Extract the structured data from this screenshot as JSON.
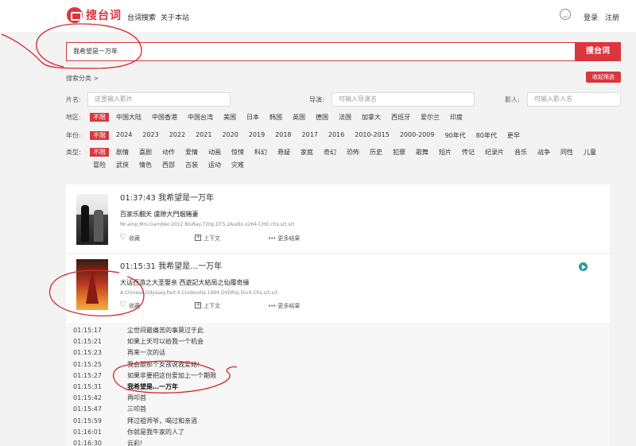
{
  "header": {
    "logo_text": "搜台词",
    "nav": [
      "台词搜索",
      "关于本站"
    ],
    "login": "登录",
    "register": "注册"
  },
  "search": {
    "value": "我希望是一万年",
    "button": "搜台词"
  },
  "category_link": "搜索分类 >",
  "advanced_button": "收起筛选",
  "fields": {
    "title_label": "片名:",
    "title_placeholder": "这里输入影片",
    "director_label": "导演:",
    "director_placeholder": "可输入导演名",
    "actor_label": "影人:",
    "actor_placeholder": "可输入影人名"
  },
  "filters": {
    "region": {
      "label": "地区:",
      "options": [
        "不限",
        "中国大陆",
        "中国香港",
        "中国台湾",
        "美国",
        "日本",
        "韩国",
        "英国",
        "德国",
        "法国",
        "加拿大",
        "西班牙",
        "爱尔兰",
        "印度"
      ]
    },
    "year": {
      "label": "年份:",
      "options": [
        "不限",
        "2024",
        "2023",
        "2022",
        "2021",
        "2020",
        "2019",
        "2018",
        "2017",
        "2016",
        "2010-2015",
        "2000-2009",
        "90年代",
        "80年代",
        "更早"
      ]
    },
    "genre": {
      "label": "类型:",
      "options": [
        "不限",
        "剧情",
        "喜剧",
        "动作",
        "爱情",
        "动画",
        "惊悚",
        "科幻",
        "悬疑",
        "家庭",
        "奇幻",
        "恐怖",
        "历史",
        "犯罪",
        "歌舞",
        "短片",
        "传记",
        "纪录片",
        "音乐",
        "战争",
        "同性",
        "儿童",
        "冒险",
        "武侠",
        "情色",
        "西部",
        "古装",
        "运动",
        "灾难"
      ]
    }
  },
  "results": [
    {
      "time": "01:37:43",
      "quote": "我希望是一万年",
      "title": "百家乐翻天 虞隙大門烟赌妻",
      "file": "Mr.amp;Mrs.Gambler.2012.BluRay.720p.DTS.2Audio.x264-CHD.chs.srt.srt",
      "favorite": "收藏",
      "context": "上下文",
      "more": "更多结果"
    },
    {
      "time": "01:15:31",
      "quote": "我希望是…一万年",
      "title": "大话西游之大圣娶亲 西遊記大結局之仙履奇緣",
      "file": "A.Chinese.Odyssey.Part.II.Cinderella.1994.DVDRip.DivX.Chs.srt.srt",
      "favorite": "收藏",
      "context": "上下文",
      "more": "更多结果"
    }
  ],
  "context_lines": [
    {
      "time": "01:15:17",
      "text": "尘世间最痛苦的事莫过于此"
    },
    {
      "time": "01:15:21",
      "text": "如果上天可以给我一个机会"
    },
    {
      "time": "01:15:23",
      "text": "再来一次的话"
    },
    {
      "time": "01:15:25",
      "text": "我会跟那个女孩说我爱她!"
    },
    {
      "time": "01:15:27",
      "text": "如果非要把这份爱加上一个期限"
    },
    {
      "time": "01:15:31",
      "text": "我希望是…一万年"
    },
    {
      "time": "01:15:42",
      "text": "再叩首"
    },
    {
      "time": "01:15:47",
      "text": "三叩首"
    },
    {
      "time": "01:15:59",
      "text": "拜过祖师爷，喝过和亲酒"
    },
    {
      "time": "01:16:01",
      "text": "你就是我牛家的人了"
    },
    {
      "time": "01:16:30",
      "text": "云彩!"
    }
  ],
  "colors": {
    "accent": "#d9363e",
    "annotation": "#d8232a"
  }
}
